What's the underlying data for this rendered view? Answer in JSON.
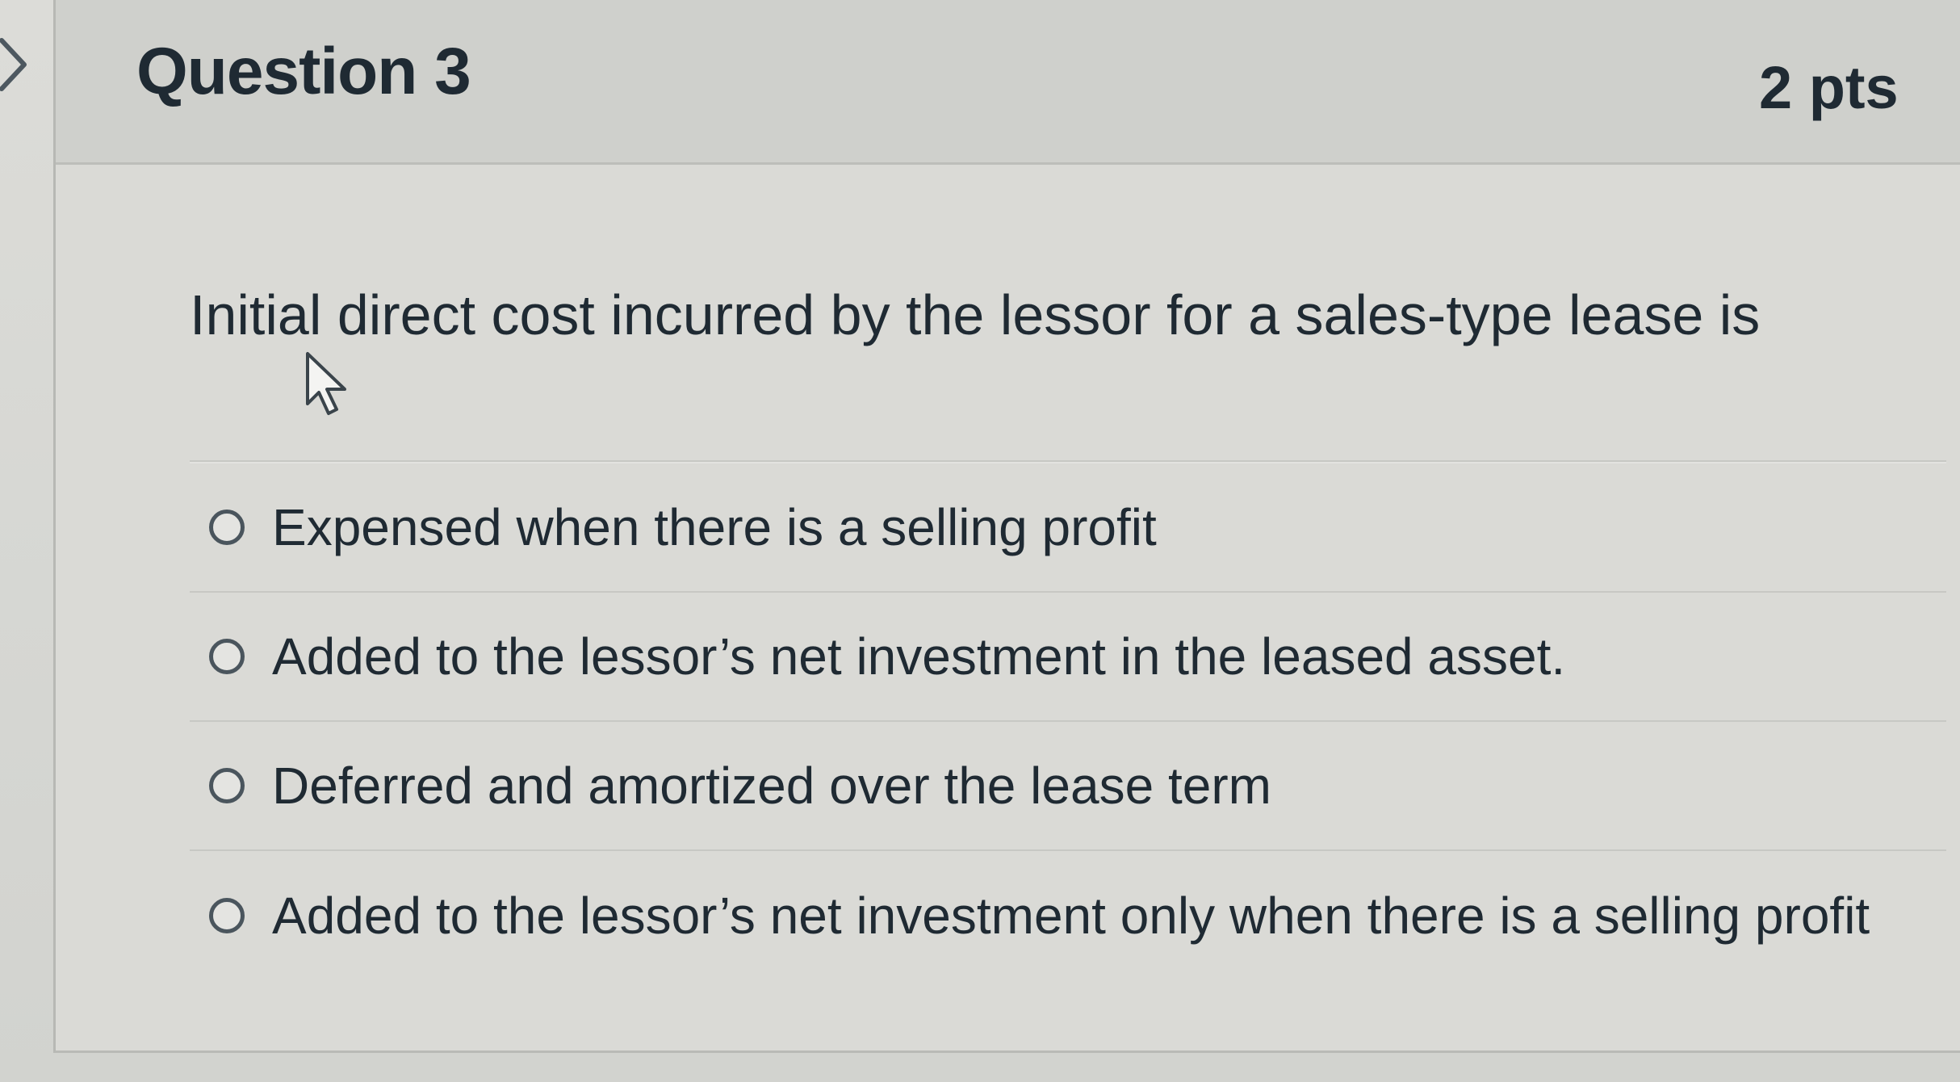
{
  "question": {
    "title": "Question 3",
    "points": "2 pts",
    "prompt": "Initial direct cost incurred by the lessor for a sales-type lease is"
  },
  "answers": [
    {
      "label": "Expensed when there is a selling profit",
      "selected": false
    },
    {
      "label": "Added to the lessor’s net investment in the leased asset.",
      "selected": false
    },
    {
      "label": "Deferred and amortized over the lease term",
      "selected": false
    },
    {
      "label": "Added to the lessor’s net investment only when there is a selling profit",
      "selected": false
    }
  ],
  "icons": {
    "nav": "chevron-right-icon",
    "pointer": "mouse-cursor-icon"
  },
  "colors": {
    "text": "#1f2a33",
    "header_bg": "#cfd0cc",
    "radio_border": "#4a555d"
  }
}
